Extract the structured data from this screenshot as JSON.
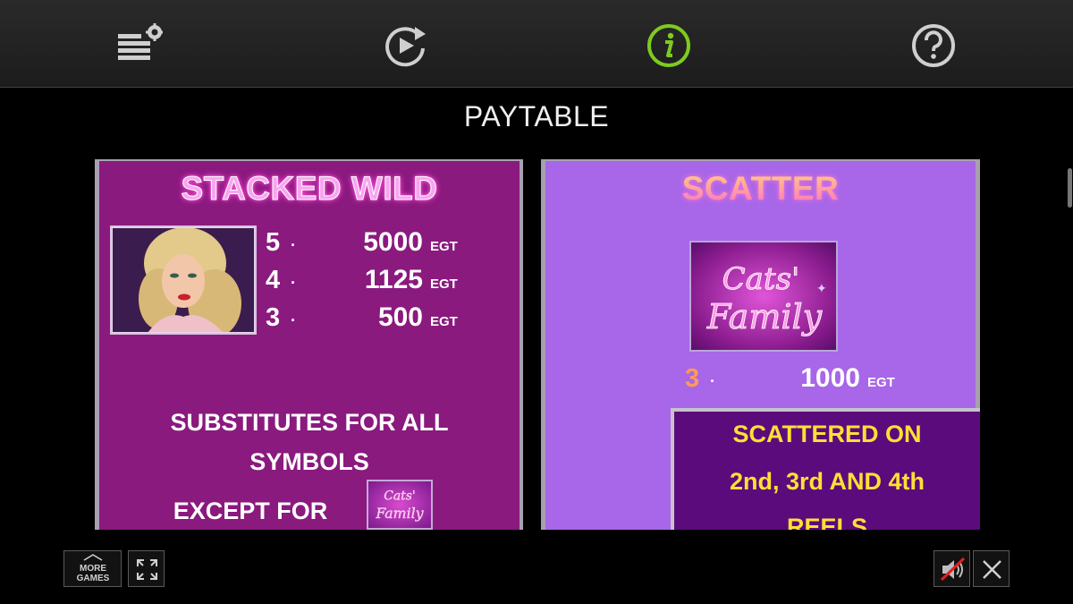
{
  "toolbar": {
    "buttons": [
      {
        "icon": "settings-list-icon"
      },
      {
        "icon": "replay-icon"
      },
      {
        "icon": "info-icon"
      },
      {
        "icon": "help-icon"
      }
    ],
    "active_color": "#7ecb20"
  },
  "title": "PAYTABLE",
  "wild_panel": {
    "heading": "STACKED WILD",
    "payouts": [
      {
        "count": "5",
        "dot": "·",
        "amount": "5000",
        "unit": "EGT"
      },
      {
        "count": "4",
        "dot": "·",
        "amount": "1125",
        "unit": "EGT"
      },
      {
        "count": "3",
        "dot": "·",
        "amount": "500",
        "unit": "EGT"
      }
    ],
    "description_line1": "SUBSTITUTES FOR ALL",
    "description_line2": "SYMBOLS",
    "description_line3": "EXCEPT FOR",
    "background": "#8a1a7e"
  },
  "scatter_panel": {
    "heading": "SCATTER",
    "logo_text_line1": "Cats'",
    "logo_text_line2": "Family",
    "payout": {
      "count": "3",
      "dot": "·",
      "amount": "1000",
      "unit": "EGT"
    },
    "note_line1": "SCATTERED ON",
    "note_line2": "2nd, 3rd AND 4th",
    "note_line3": "REELS",
    "background": "#a866e8",
    "note_background": "#5c0b7c",
    "note_color": "#ffe035"
  },
  "bottom": {
    "more_games_line1": "MORE",
    "more_games_line2": "GAMES",
    "fullscreen_icon": "fullscreen-icon",
    "mute_icon": "sound-muted-icon",
    "close_icon": "close-icon"
  }
}
